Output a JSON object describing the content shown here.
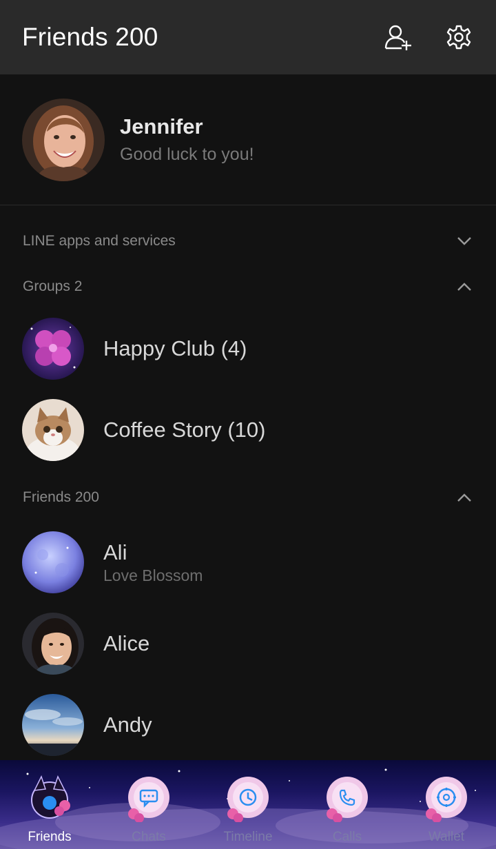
{
  "header": {
    "title": "Friends 200",
    "add_friend_icon": "person-add-icon",
    "settings_icon": "gear-icon"
  },
  "profile": {
    "name": "Jennifer",
    "status": "Good luck to you!"
  },
  "sections": {
    "services": {
      "label": "LINE apps and services",
      "state": "collapsed"
    },
    "groups": {
      "label": "Groups 2",
      "state": "expanded"
    },
    "friends": {
      "label": "Friends 200",
      "state": "expanded"
    }
  },
  "groups": [
    {
      "name": "Happy Club (4)"
    },
    {
      "name": "Coffee Story (10)"
    }
  ],
  "friends": [
    {
      "name": "Ali",
      "status": "Love Blossom"
    },
    {
      "name": "Alice",
      "status": ""
    },
    {
      "name": "Andy",
      "status": ""
    }
  ],
  "tabs": [
    {
      "label": "Friends",
      "icon": "friends-icon",
      "active": true
    },
    {
      "label": "Chats",
      "icon": "chat-icon",
      "active": false
    },
    {
      "label": "Timeline",
      "icon": "clock-icon",
      "active": false
    },
    {
      "label": "Calls",
      "icon": "phone-icon",
      "active": false
    },
    {
      "label": "Wallet",
      "icon": "wallet-icon",
      "active": false
    }
  ],
  "colors": {
    "header_bg": "#2a2a2a",
    "body_bg": "#121212",
    "tab_icon_blue": "#2a8ef0"
  }
}
